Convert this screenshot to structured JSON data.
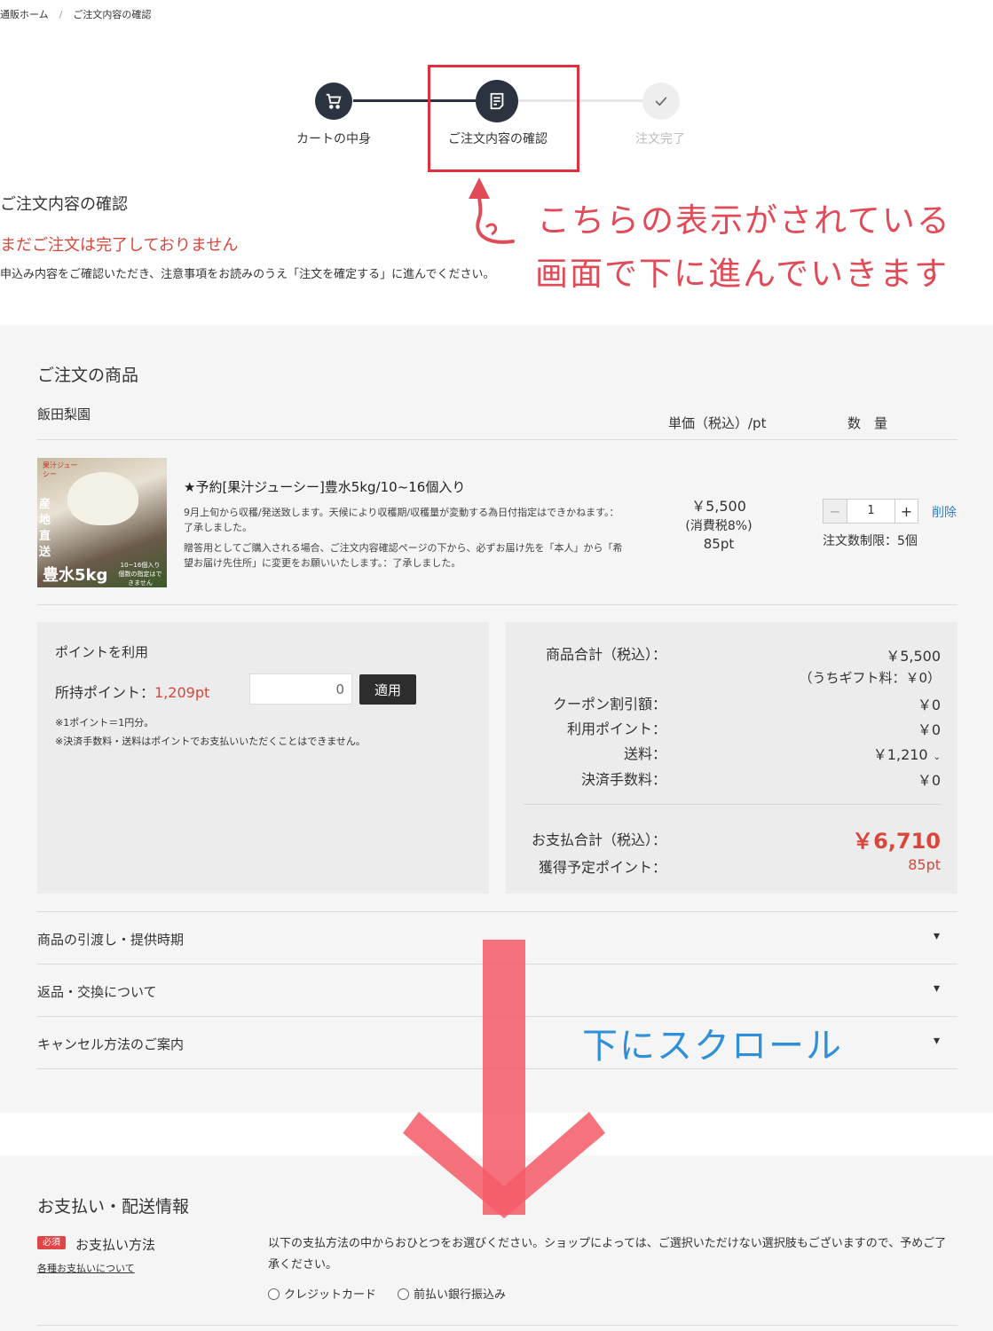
{
  "breadcrumb": {
    "home": "通販ホーム",
    "separator": "/",
    "current": "ご注文内容の確認"
  },
  "steps": [
    {
      "label": "カートの中身",
      "icon": "cart-icon"
    },
    {
      "label": "ご注文内容の確認",
      "icon": "document-icon"
    },
    {
      "label": "注文完了",
      "icon": "check-icon"
    }
  ],
  "header": {
    "title": "ご注文内容の確認",
    "not_complete": "まだご注文は完了しておりません",
    "intro": "申込み内容をご確認いただき、注意事項をお読みのうえ「注文を確定する」に進んでください。"
  },
  "annotations": {
    "line1": "こちらの表示がされている",
    "line2": "画面で下に進んでいきます",
    "scroll": "下にスクロール"
  },
  "order": {
    "title": "ご注文の商品",
    "shop": "飯田梨園",
    "col_price": "単価（税込）/pt",
    "col_qty": "数　量",
    "product": {
      "name": "★予約[果汁ジューシー]豊水5kg/10~16個入り",
      "desc1": "9月上旬から収穫/発送致します。天候により収穫期/収穫量が変動する為日付指定はできかねます。：了承しました。",
      "desc2": "贈答用としてご購入される場合、ご注文内容確認ページの下から、必ずお届け先を「本人」から「希望お届け先住所」に変更をお願いいたします。：了承しました。",
      "price": "￥5,500",
      "tax": "(消費税8%)",
      "points": "85pt",
      "qty": "1",
      "delete": "削除",
      "limit": "注文数制限：5個",
      "image_text_main": "豊水5kg",
      "image_text_side": "産地直送",
      "image_text_corner": "果汁ジューシー",
      "image_text_note": "10~16個入り 個数の指定はできません"
    }
  },
  "points_box": {
    "title": "ポイントを利用",
    "owned_label": "所持ポイント：",
    "owned_value": "1,209pt",
    "input_value": "0",
    "apply": "適用",
    "note1": "※1ポイント＝1円分。",
    "note2": "※決済手数料・送料はポイントでお支払いいただくことはできません。"
  },
  "summary": {
    "subtotal_label": "商品合計（税込）：",
    "subtotal_value": "￥5,500",
    "gift_note": "（うちギフト料：￥0）",
    "coupon_label": "クーポン割引額：",
    "coupon_value": "￥0",
    "points_label": "利用ポイント：",
    "points_value": "￥0",
    "shipping_label": "送料：",
    "shipping_value": "￥1,210",
    "fee_label": "決済手数料：",
    "fee_value": "￥0",
    "total_label": "お支払合計（税込）：",
    "total_value": "￥6,710",
    "earn_label": "獲得予定ポイント：",
    "earn_value": "85pt"
  },
  "accordion": [
    "商品の引渡し・提供時期",
    "返品・交換について",
    "キャンセル方法のご案内"
  ],
  "payment": {
    "title": "お支払い・配送情報",
    "required": "必須",
    "method_label": "お支払い方法",
    "about_link": "各種お支払いについて",
    "desc": "以下の支払方法の中からおひとつをお選びください。ショップによっては、ご選択いただけない選択肢もございますので、予めご了承ください。",
    "options": [
      "クレジットカード",
      "前払い銀行振込み"
    ]
  },
  "colors": {
    "accent_red": "#d9463a",
    "annotation_red": "#e04b57",
    "annotation_blue": "#2f8fd8",
    "dark": "#2d2d2d"
  }
}
